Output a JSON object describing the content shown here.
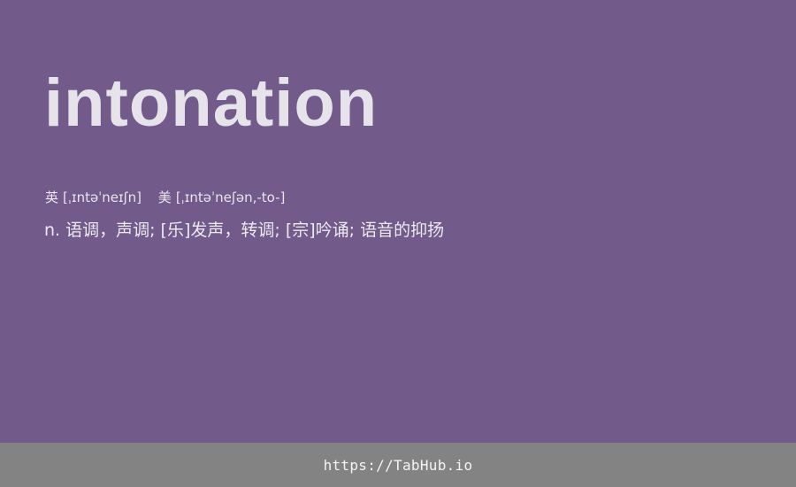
{
  "entry": {
    "word": "intonation",
    "phonetics": {
      "uk_label": "英",
      "uk_ipa": "[ˌɪntəˈneɪʃn]",
      "us_label": "美",
      "us_ipa": "[ˌɪntəˈneʃən,-to-]"
    },
    "definition": "n. 语调，声调; [乐]发声，转调; [宗]吟诵; 语音的抑扬"
  },
  "footer": {
    "link_text": "https://TabHub.io"
  },
  "colors": {
    "background": "#725a8a",
    "footer_background": "#838383",
    "text": "#e6e4ea"
  }
}
